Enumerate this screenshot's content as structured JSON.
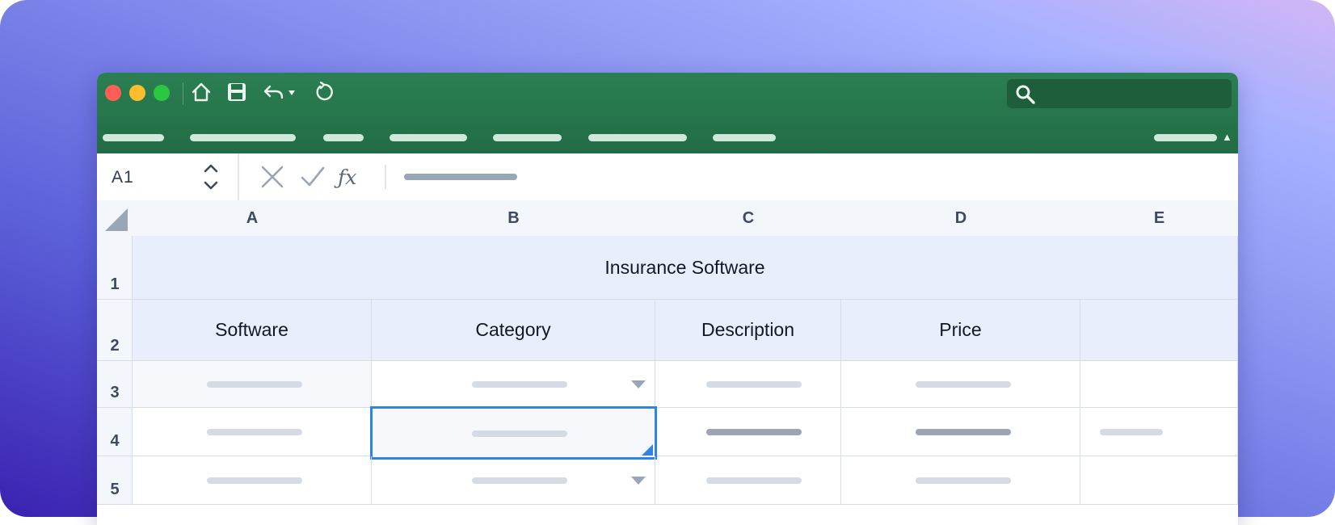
{
  "toolbar": {
    "home_icon": "home-icon",
    "save_icon": "save-icon",
    "undo_icon": "undo-icon",
    "redo_icon": "refresh-icon",
    "search_icon": "search-icon",
    "search_placeholder": ""
  },
  "formula_bar": {
    "name_box": "A1",
    "cancel_icon": "close-icon",
    "confirm_icon": "check-icon",
    "fx_label": "ƒx"
  },
  "columns": [
    "A",
    "B",
    "C",
    "D",
    "E"
  ],
  "rows": [
    "1",
    "2",
    "3",
    "4",
    "5"
  ],
  "sheet": {
    "title": "Insurance Software",
    "headers": [
      "Software",
      "Category",
      "Description",
      "Price"
    ]
  },
  "colors": {
    "ribbon": "#247349",
    "selection": "#2f83e4",
    "header_fill": "#e8eefb"
  }
}
